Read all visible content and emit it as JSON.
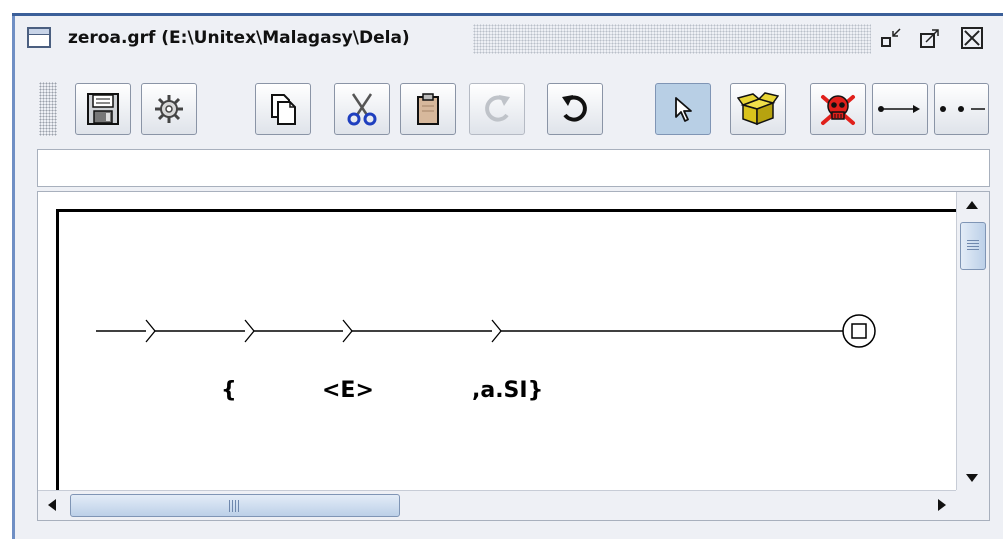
{
  "window": {
    "title": "zeroa.grf (E:\\Unitex\\Malagasy\\Dela)",
    "icon": "window-icon",
    "controls": [
      "iconify-icon",
      "maximize-icon",
      "close-icon"
    ]
  },
  "toolbar": {
    "buttons": [
      {
        "icon": "save-icon",
        "label": ""
      },
      {
        "icon": "compile-gear-icon",
        "label": ""
      },
      {
        "icon": "copy-icon",
        "label": ""
      },
      {
        "icon": "cut-scissors-icon",
        "label": ""
      },
      {
        "icon": "paste-clipboard-icon",
        "label": ""
      },
      {
        "icon": "redo-icon",
        "label": "",
        "disabled": true
      },
      {
        "icon": "undo-icon",
        "label": ""
      },
      {
        "icon": "select-arrow-icon",
        "label": "",
        "selected": true
      },
      {
        "icon": "open-box-icon",
        "label": ""
      },
      {
        "icon": "skull-delete-icon",
        "label": ""
      },
      {
        "icon": "link-arrow-icon",
        "label": ""
      },
      {
        "icon": "reverse-link-icon",
        "label": ""
      }
    ]
  },
  "text_field": {
    "value": ""
  },
  "graph": {
    "boxes": [
      {
        "label": ""
      },
      {
        "label": "{"
      },
      {
        "label": "<E>"
      },
      {
        "label": ",a.SI}"
      }
    ],
    "final_state": "final-state-icon"
  },
  "colors": {
    "title_bar_edge": "#3b5f99",
    "selected_button": "#b8cfe5",
    "skull_red": "#e0201b",
    "box_yellow": "#d9c31c"
  }
}
